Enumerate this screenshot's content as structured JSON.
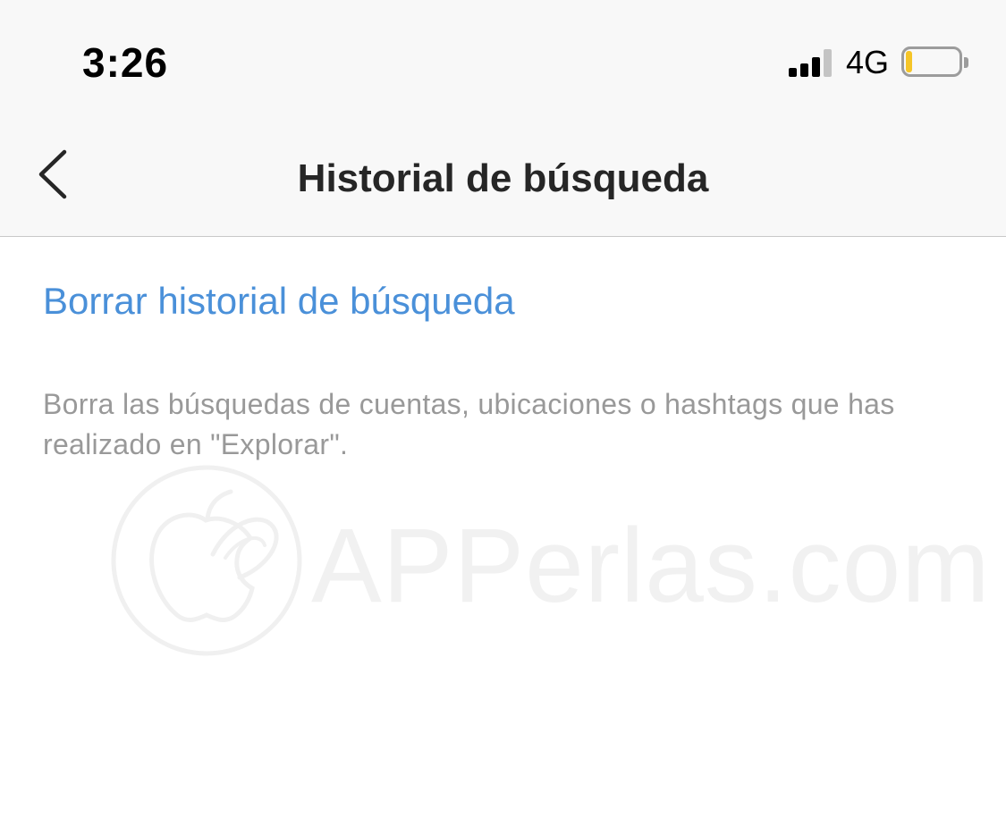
{
  "status_bar": {
    "time": "3:26",
    "network": "4G",
    "signal_bars_filled": 3,
    "signal_bars_total": 4,
    "battery_level_fraction": 0.12,
    "battery_color": "#f5c528"
  },
  "nav": {
    "back_icon": "chevron-left-icon",
    "title": "Historial de búsqueda"
  },
  "content": {
    "clear_history_label": "Borrar historial de búsqueda",
    "description": "Borra las búsquedas de cuentas, ubicaciones o hashtags que has realizado en \"Explorar\"."
  },
  "watermark": {
    "text": "APPerlas.com"
  },
  "colors": {
    "link": "#4a90d9",
    "description": "#999999",
    "title": "#262626",
    "bar_background": "#f8f8f8"
  }
}
